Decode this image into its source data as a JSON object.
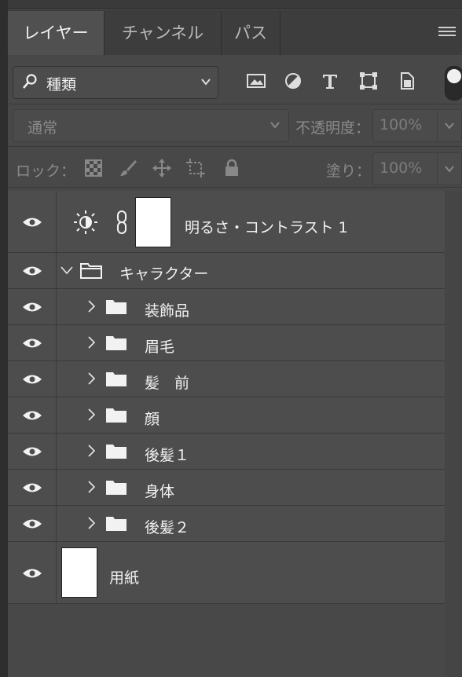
{
  "tabs": [
    {
      "label": "レイヤー",
      "active": true
    },
    {
      "label": "チャンネル",
      "active": false
    },
    {
      "label": "パス",
      "active": false
    }
  ],
  "filter": {
    "label": "種類"
  },
  "blend": {
    "mode": "通常",
    "opacity_label": "不透明度：",
    "opacity_value": "100%",
    "lock_label": "ロック：",
    "fill_label": "塗り：",
    "fill_value": "100%"
  },
  "layers": [
    {
      "name": "明るさ・コントラスト 1",
      "type": "adjustment"
    },
    {
      "name": "キャラクター",
      "type": "group-open"
    },
    {
      "name": "装飾品",
      "type": "group"
    },
    {
      "name": "眉毛",
      "type": "group"
    },
    {
      "name": "髪　前",
      "type": "group"
    },
    {
      "name": "顔",
      "type": "group"
    },
    {
      "name": "後髪１",
      "type": "group"
    },
    {
      "name": "身体",
      "type": "group"
    },
    {
      "name": "後髪２",
      "type": "group"
    },
    {
      "name": "用紙",
      "type": "pixel"
    }
  ]
}
